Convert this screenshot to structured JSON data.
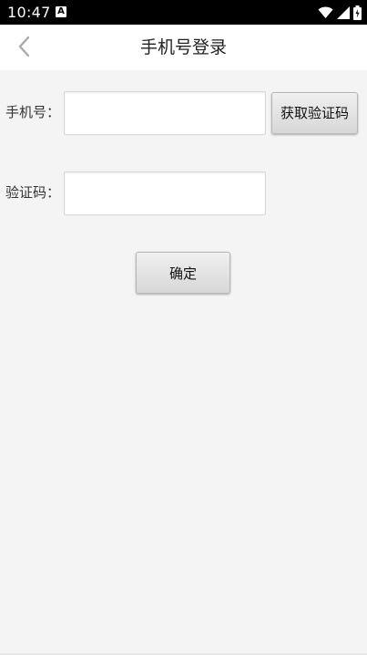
{
  "status_bar": {
    "time": "10:47",
    "notification_icon": "a-icon",
    "icons": [
      "wifi-icon",
      "cellular-signal-icon",
      "battery-icon"
    ]
  },
  "app_bar": {
    "back_icon": "chevron-left-icon",
    "title": "手机号登录"
  },
  "form": {
    "phone_label": "手机号：",
    "phone_value": "",
    "get_code_button": "获取验证码",
    "code_label": "验证码：",
    "code_value": "",
    "confirm_button": "确定"
  },
  "colors": {
    "background": "#f4f4f4",
    "app_bar": "#ffffff",
    "status_bar": "#000000",
    "button_gradient_top": "#f0f0f0",
    "button_gradient_bottom": "#d7d7d7"
  }
}
